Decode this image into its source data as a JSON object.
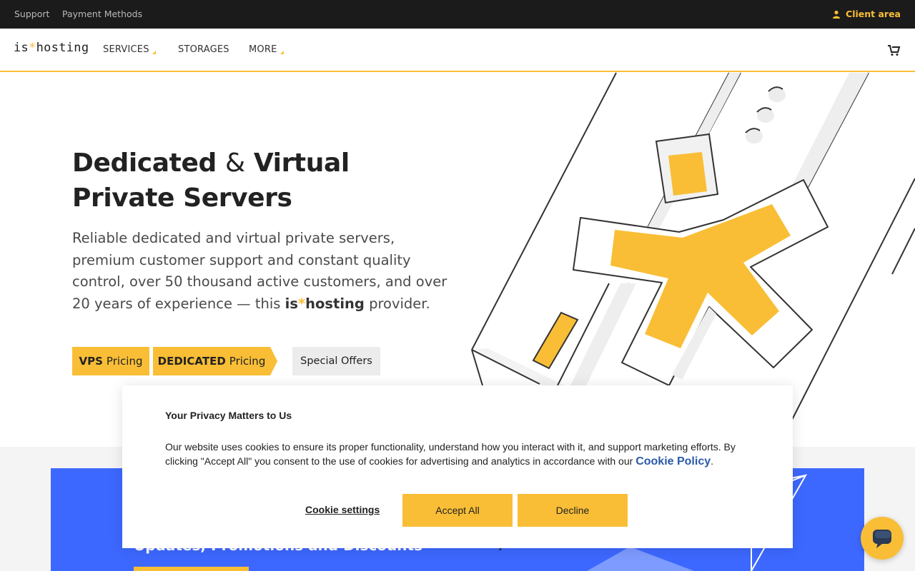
{
  "topbar": {
    "support": "Support",
    "payment_methods": "Payment Methods",
    "client_area": "Client area"
  },
  "nav": {
    "logo_prefix": "is",
    "logo_star": "*",
    "logo_suffix": "hosting",
    "items": [
      "SERVICES",
      "STORAGES",
      "MORE"
    ]
  },
  "hero": {
    "title_line1_a": "Dedicated",
    "title_amp": "&",
    "title_line1_b": "Virtual",
    "title_line2": "Private Servers",
    "description": "Reliable dedicated and virtual private servers, premium customer support and constant quality control, over 50 thousand active customers, and over 20 years of experience — this",
    "brand_prefix": "is",
    "brand_star": "*",
    "brand_suffix": "hosting",
    "description_end": "provider."
  },
  "buttons": {
    "vps_bold": "VPS",
    "vps_rest": "Pricing",
    "ded_bold": "DEDICATED",
    "ded_rest": "Pricing",
    "special": "Special Offers"
  },
  "promo": {
    "text": "Updates, Promotions and Discounts"
  },
  "cookie": {
    "title": "Your Privacy Matters to Us",
    "body": "Our website uses cookies to ensure its proper functionality, understand how you interact with it, and support marketing efforts. By clicking \"Accept All\" you consent to the use of cookies for advertising and analytics in accordance with our",
    "link": "Cookie Policy",
    "settings": "Cookie settings",
    "accept": "Accept All",
    "decline": "Decline"
  },
  "colors": {
    "accent": "#f9be36",
    "topbar": "#1b1b1b",
    "promo": "#3d68ff"
  },
  "icons": {
    "client": "user-icon",
    "cart": "cart-icon",
    "chat": "chat-icon"
  }
}
